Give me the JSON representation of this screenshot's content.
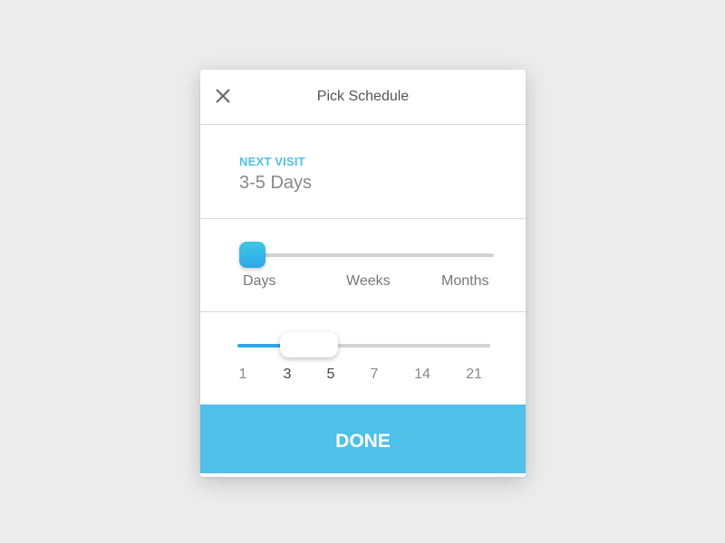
{
  "dialog": {
    "title": "Pick Schedule",
    "close_icon": "close-icon"
  },
  "next_visit": {
    "label": "NEXT VISIT",
    "value": "3-5 Days"
  },
  "unit_slider": {
    "options": [
      "Days",
      "Weeks",
      "Months"
    ],
    "selected": "Days",
    "selected_index": 0
  },
  "range_slider": {
    "ticks": [
      "1",
      "3",
      "5",
      "7",
      "14",
      "21"
    ],
    "range_start": "3",
    "range_end": "5"
  },
  "done_button": {
    "label": "DONE"
  },
  "colors": {
    "accent": "#4fc0e8",
    "thumb": "#2ea7e8"
  }
}
